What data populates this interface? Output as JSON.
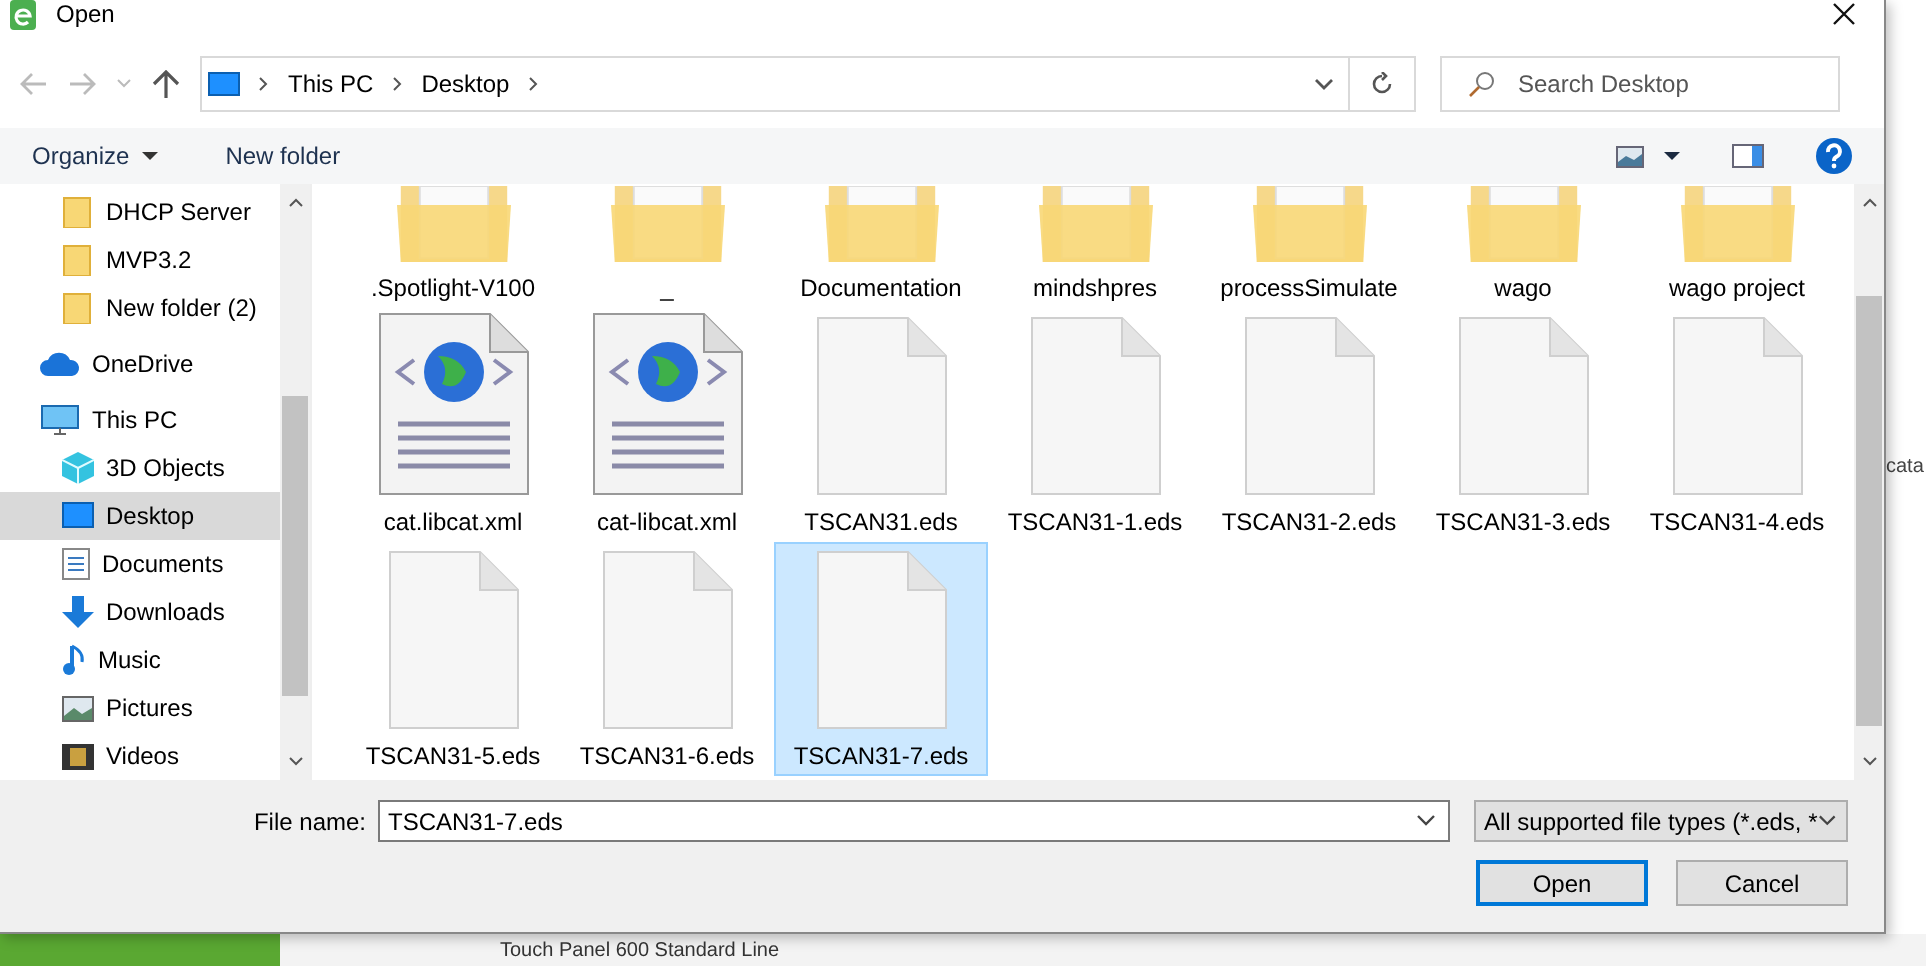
{
  "window": {
    "title": "Open"
  },
  "address": {
    "crumbs": [
      "This PC",
      "Desktop"
    ]
  },
  "search": {
    "placeholder": "Search Desktop"
  },
  "toolbar": {
    "buttons": [
      "Organize",
      "New folder"
    ]
  },
  "sidebar": {
    "items": [
      {
        "label": "DHCP Server",
        "kind": "folder",
        "selected": false
      },
      {
        "label": "MVP3.2",
        "kind": "folder",
        "selected": false
      },
      {
        "label": "New folder (2)",
        "kind": "folder",
        "selected": false
      },
      {
        "label": "OneDrive",
        "kind": "cloud",
        "selected": false
      },
      {
        "label": "This PC",
        "kind": "pc",
        "selected": false
      },
      {
        "label": "3D Objects",
        "kind": "cube",
        "selected": false
      },
      {
        "label": "Desktop",
        "kind": "desktop",
        "selected": true
      },
      {
        "label": "Documents",
        "kind": "docs",
        "selected": false
      },
      {
        "label": "Downloads",
        "kind": "download",
        "selected": false
      },
      {
        "label": "Music",
        "kind": "music",
        "selected": false
      },
      {
        "label": "Pictures",
        "kind": "pictures",
        "selected": false
      },
      {
        "label": "Videos",
        "kind": "videos",
        "selected": false
      }
    ]
  },
  "files": [
    {
      "name": ".Spotlight-V100",
      "kind": "folder",
      "selected": false
    },
    {
      "name": "_",
      "kind": "folder",
      "selected": false
    },
    {
      "name": "Documentation",
      "kind": "folder",
      "selected": false
    },
    {
      "name": "mindshpres",
      "kind": "folder",
      "selected": false
    },
    {
      "name": "processSimulate",
      "kind": "folder",
      "selected": false
    },
    {
      "name": "wago",
      "kind": "folder",
      "selected": false
    },
    {
      "name": "wago project",
      "kind": "folder",
      "selected": false
    },
    {
      "name": "cat.libcat.xml",
      "kind": "xml",
      "selected": false
    },
    {
      "name": "cat-libcat.xml",
      "kind": "xml",
      "selected": false
    },
    {
      "name": "TSCAN31.eds",
      "kind": "file",
      "selected": false
    },
    {
      "name": "TSCAN31-1.eds",
      "kind": "file",
      "selected": false
    },
    {
      "name": "TSCAN31-2.eds",
      "kind": "file",
      "selected": false
    },
    {
      "name": "TSCAN31-3.eds",
      "kind": "file",
      "selected": false
    },
    {
      "name": "TSCAN31-4.eds",
      "kind": "file",
      "selected": false
    },
    {
      "name": "TSCAN31-5.eds",
      "kind": "file",
      "selected": false
    },
    {
      "name": "TSCAN31-6.eds",
      "kind": "file",
      "selected": false
    },
    {
      "name": "TSCAN31-7.eds",
      "kind": "file",
      "selected": true
    }
  ],
  "filename": {
    "label": "File name:",
    "value": "TSCAN31-7.eds"
  },
  "filetype": {
    "value": "All supported file types (*.eds, *"
  },
  "buttons": [
    "Open",
    "Cancel"
  ],
  "background": {
    "side_text": "cata",
    "bottom_text": "Touch Panel 600 Standard Line"
  }
}
